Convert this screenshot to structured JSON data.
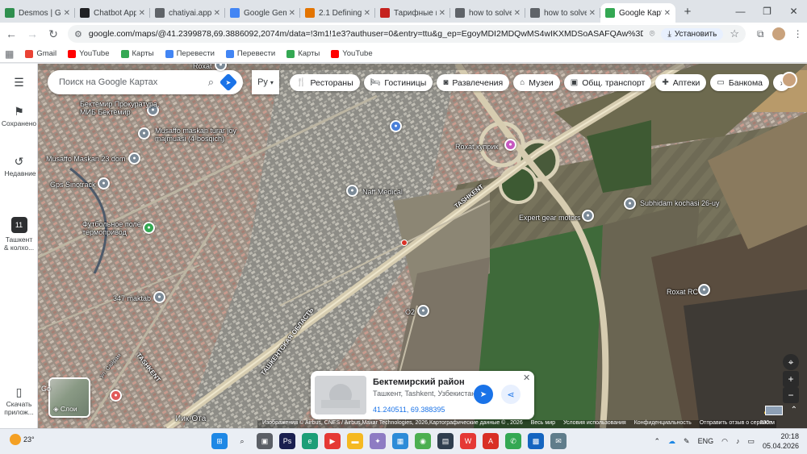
{
  "browser": {
    "tabs": [
      {
        "title": "Desmos | Graphing",
        "favicon": "desmos-icon",
        "color": "#2f8f4e"
      },
      {
        "title": "Chatbot App",
        "favicon": "chatbot-icon",
        "color": "#202124"
      },
      {
        "title": "chatiyai.app",
        "favicon": "globe-icon",
        "color": "#5f6368"
      },
      {
        "title": "Google Gemini",
        "favicon": "gemini-icon",
        "color": "#4285f4"
      },
      {
        "title": "2.1 Defining",
        "favicon": "doc-icon",
        "color": "#e37400"
      },
      {
        "title": "Тарифные п",
        "favicon": "bookmark-icon",
        "color": "#c5221f"
      },
      {
        "title": "how to solve",
        "favicon": "globe-icon",
        "color": "#5f6368"
      },
      {
        "title": "how to solve",
        "favicon": "globe-icon",
        "color": "#5f6368"
      },
      {
        "title": "Google Карты",
        "favicon": "maps-pin-icon",
        "color": "#34a853",
        "active": true
      }
    ],
    "url": "google.com/maps/@41.2399878,69.3886092,2074m/data=!3m1!1e3?authuser=0&entry=ttu&g_ep=EgoyMDI2MDQwMS4wIKXMDSoASAFQAw%3D%3D",
    "install_label": "Установить",
    "bookmarks": [
      {
        "label": "Gmail",
        "icon": "gmail-icon",
        "color": "#ea4335"
      },
      {
        "label": "YouTube",
        "icon": "youtube-icon",
        "color": "#ff0000"
      },
      {
        "label": "Карты",
        "icon": "maps-icon",
        "color": "#34a853"
      },
      {
        "label": "Перевести",
        "icon": "translate-icon",
        "color": "#4285f4"
      },
      {
        "label": "Перевести",
        "icon": "translate-icon",
        "color": "#4285f4"
      },
      {
        "label": "Карты",
        "icon": "maps-icon",
        "color": "#34a853"
      },
      {
        "label": "YouTube",
        "icon": "youtube-icon",
        "color": "#ff0000"
      }
    ]
  },
  "rail": {
    "saved": "Сохранено",
    "recent": "Недавние",
    "app": "Ташкент & колхо...",
    "download": "Скачать прилож..."
  },
  "search": {
    "placeholder": "Поиск на Google Картах",
    "lang": "Ру"
  },
  "chips": [
    {
      "label": "Рестораны",
      "icon": "restaurant-icon",
      "glyph": "🍴"
    },
    {
      "label": "Гостиницы",
      "icon": "hotel-icon",
      "glyph": "🛏"
    },
    {
      "label": "Развлечения",
      "icon": "camera-icon",
      "glyph": "◙"
    },
    {
      "label": "Музеи",
      "icon": "museum-icon",
      "glyph": "⌂"
    },
    {
      "label": "Общ. транспорт",
      "icon": "transit-icon",
      "glyph": "▣"
    },
    {
      "label": "Аптеки",
      "icon": "pharmacy-icon",
      "glyph": "✚"
    },
    {
      "label": "Банкома",
      "icon": "atm-icon",
      "glyph": "▭"
    }
  ],
  "places": [
    {
      "name": "Бектемир Прокуратура, МИБ Бектемир"
    },
    {
      "name": "Musaffo maskan turar joy majmuasi (4-bosqich)"
    },
    {
      "name": "Musaffo Maskan 23 dom"
    },
    {
      "name": "Gps Sinotrack"
    },
    {
      "name": "Naff Medical"
    },
    {
      "name": "Футбольное поле термопривод"
    },
    {
      "name": "347 maktab"
    },
    {
      "name": "O2"
    },
    {
      "name": "Roxat куприк"
    },
    {
      "name": "Expert gear motors"
    },
    {
      "name": "Subhidam kochasi 26-uy"
    },
    {
      "name": "Roxat RC"
    },
    {
      "name": "Roxat"
    }
  ],
  "road_labels": {
    "tashkent_road_1": "TASHKENT",
    "tashkent_road_2": "TASHKENT",
    "region": "ТАШКЕНТСКАЯ ОБЛАСТЬ",
    "ik_ota": "Иик-Ота",
    "street": "ул. Сайрам"
  },
  "layers_label": "Слои",
  "card": {
    "title": "Бектемирский район",
    "subtitle": "Ташкент, Tashkent, Узбекистан",
    "coords": "41.240511, 69.388395"
  },
  "attribution": {
    "imagery": "Изображения © Airbus, CNES / Airbus,Maxar Technologies, 2026,Картографические данные © , 2026",
    "worldwide": "Весь мир",
    "terms": "Условия использования",
    "privacy": "Конфиденциальность",
    "feedback": "Отправить отзыв о сервисе",
    "scale": "200 м"
  },
  "taskbar": {
    "temp": "23°",
    "lang": "ENG",
    "time": "20:18",
    "date": "05.04.2026"
  }
}
